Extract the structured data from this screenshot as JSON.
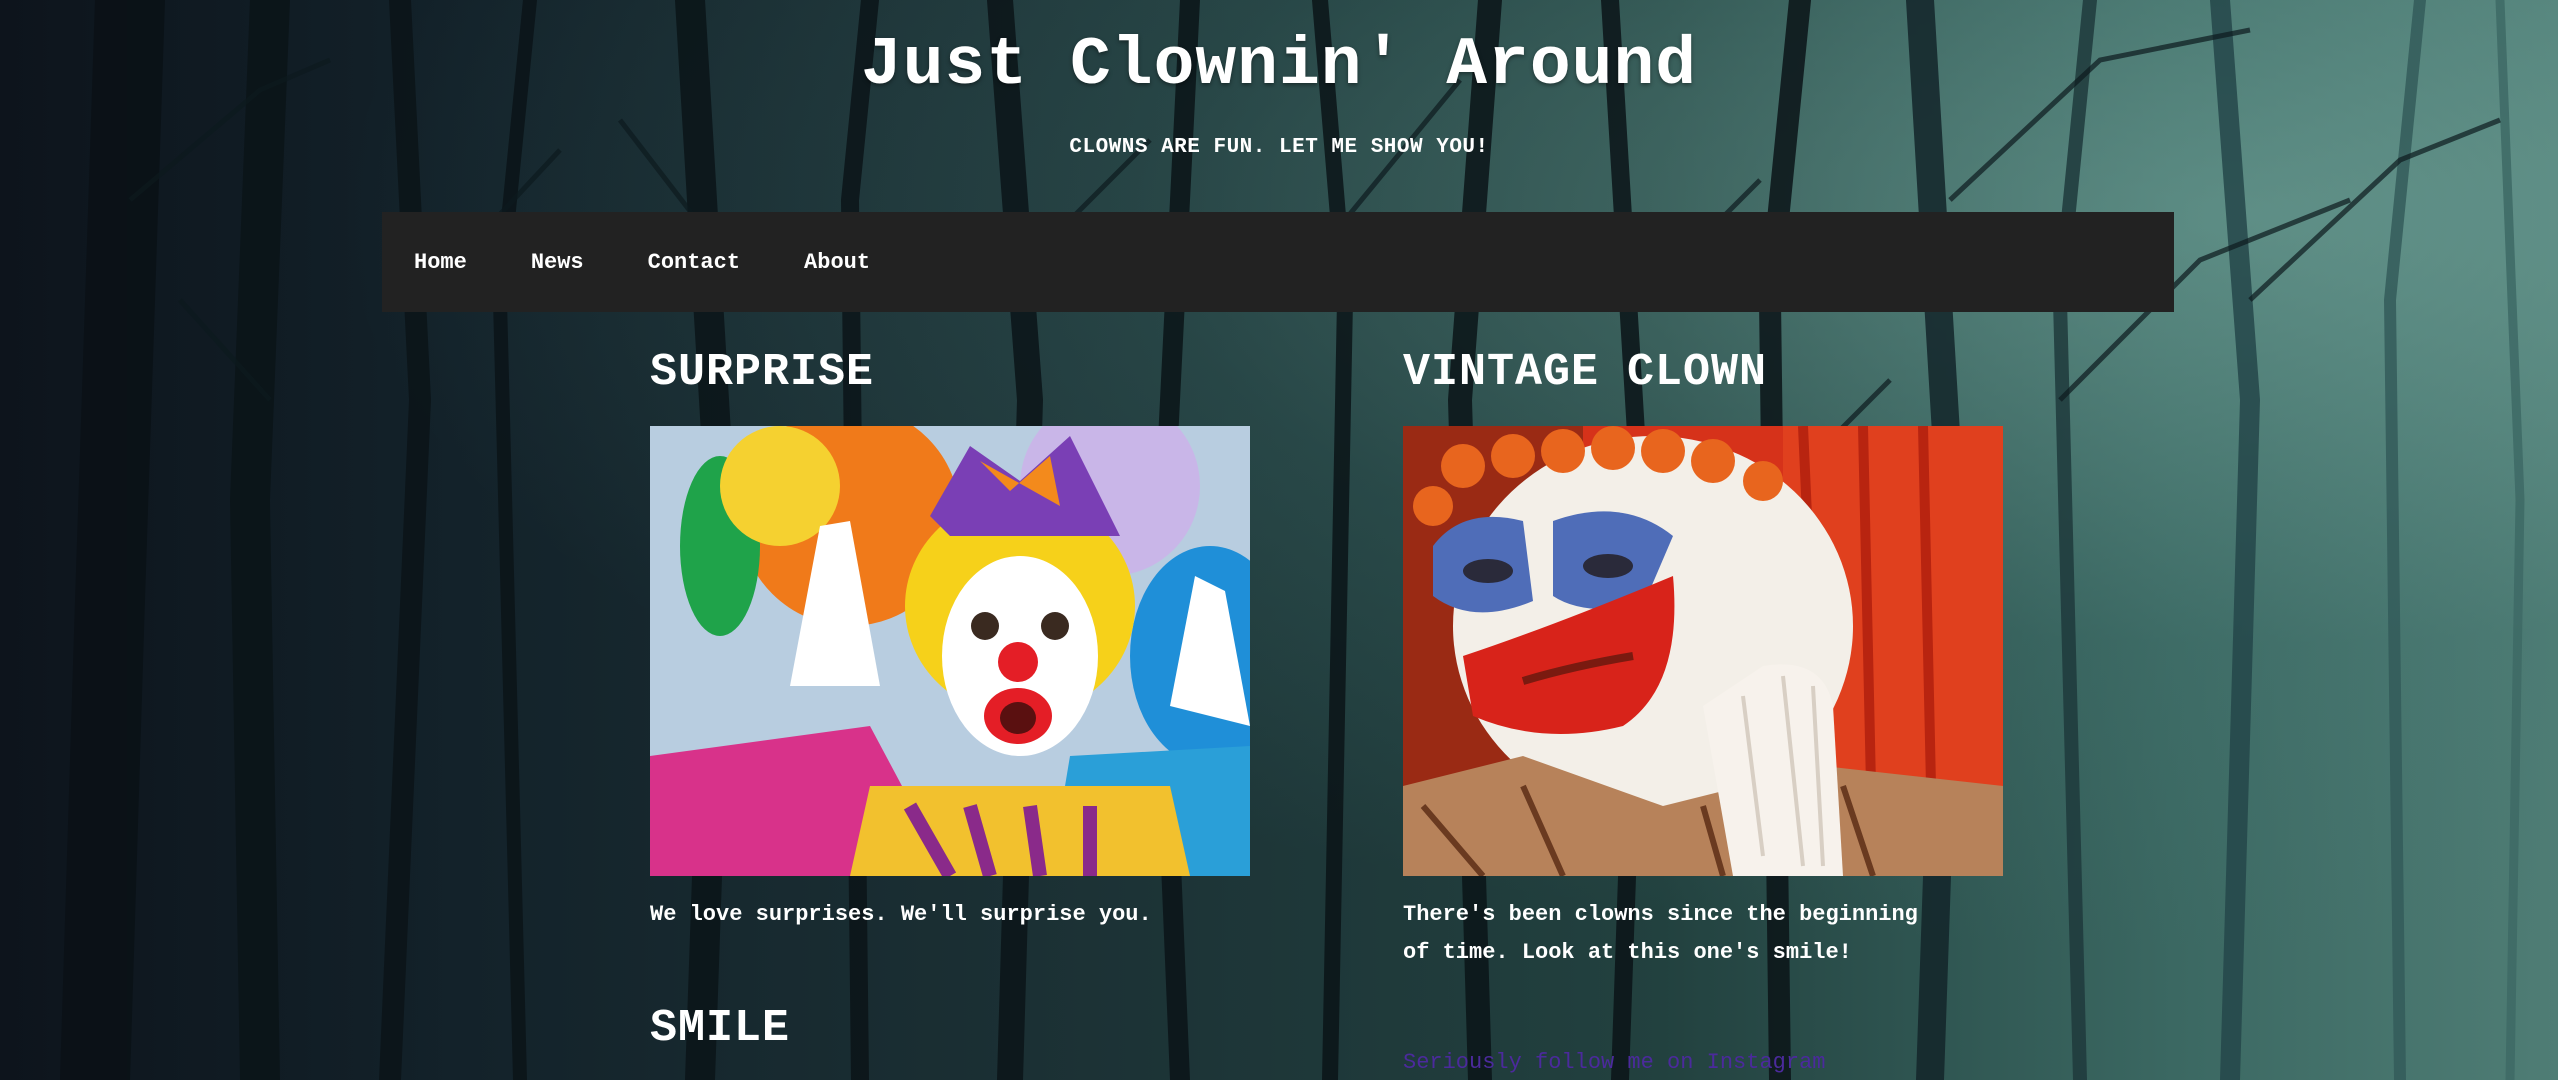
{
  "site": {
    "title": "Just Clownin' Around",
    "tagline": "CLOWNS ARE FUN. LET ME SHOW YOU!"
  },
  "nav": {
    "items": [
      {
        "label": "Home"
      },
      {
        "label": "News"
      },
      {
        "label": "Contact"
      },
      {
        "label": "About"
      }
    ]
  },
  "posts": [
    {
      "title": "SURPRISE",
      "text": "We love surprises. We'll surprise you.",
      "image_icon": "surprised-clown-photo"
    },
    {
      "title": "VINTAGE CLOWN",
      "text": "There's been clowns since the beginning of time. Look at this one's smile!",
      "image_icon": "vintage-clown-photo"
    },
    {
      "title": "SMILE"
    }
  ],
  "instagram": {
    "link_text": "Seriously follow me on Instagram"
  },
  "colors": {
    "navbar": "#222222",
    "text": "#ffffff",
    "link": "#4b2a9c"
  }
}
